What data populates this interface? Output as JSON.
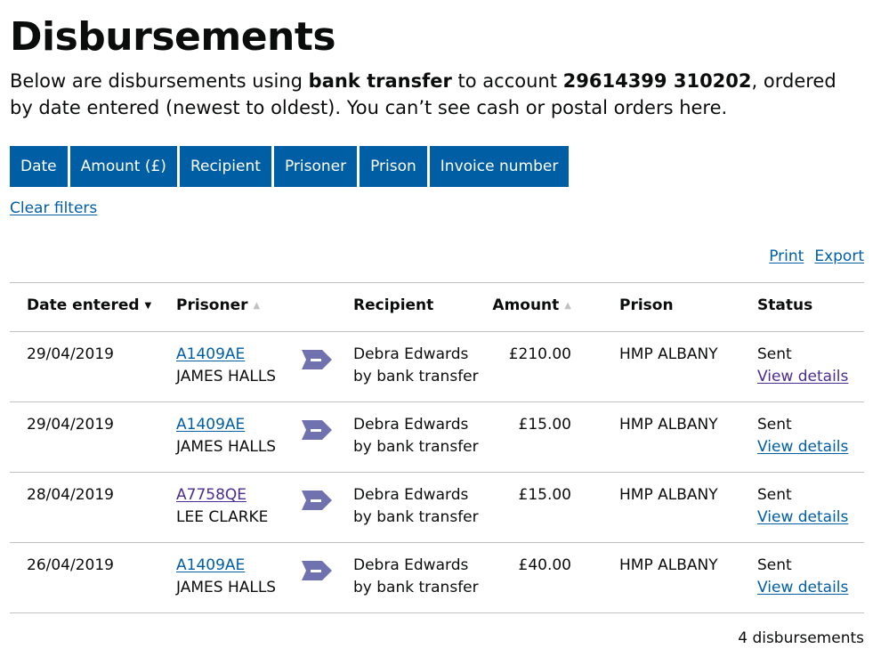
{
  "page": {
    "title": "Disbursements",
    "lede": {
      "part1": "Below are disbursements using ",
      "bold1": "bank transfer",
      "part2": " to account ",
      "bold2": "29614399 310202",
      "part3": ", ordered by date entered (newest to oldest). You can’t see cash or postal orders here."
    }
  },
  "filters": [
    "Date",
    "Amount (£)",
    "Recipient",
    "Prisoner",
    "Prison",
    "Invoice number"
  ],
  "clear_filters": "Clear filters",
  "actions": {
    "print": "Print",
    "export": "Export"
  },
  "table": {
    "headers": {
      "date": "Date entered",
      "prisoner": "Prisoner",
      "recipient": "Recipient",
      "amount": "Amount",
      "prison": "Prison",
      "status": "Status"
    },
    "rows": [
      {
        "date": "29/04/2019",
        "prisoner_number": "A1409AE",
        "prisoner_name": "JAMES HALLS",
        "recipient": "Debra Edwards",
        "method": "by bank transfer",
        "amount": "£210.00",
        "prison": "HMP ALBANY",
        "status": "Sent",
        "link": "View details"
      },
      {
        "date": "29/04/2019",
        "prisoner_number": "A1409AE",
        "prisoner_name": "JAMES HALLS",
        "recipient": "Debra Edwards",
        "method": "by bank transfer",
        "amount": "£15.00",
        "prison": "HMP ALBANY",
        "status": "Sent",
        "link": "View details"
      },
      {
        "date": "28/04/2019",
        "prisoner_number": "A7758QE",
        "prisoner_name": "LEE CLARKE",
        "recipient": "Debra Edwards",
        "method": "by bank transfer",
        "amount": "£15.00",
        "prison": "HMP ALBANY",
        "status": "Sent",
        "link": "View details"
      },
      {
        "date": "26/04/2019",
        "prisoner_number": "A1409AE",
        "prisoner_name": "JAMES HALLS",
        "recipient": "Debra Edwards",
        "method": "by bank transfer",
        "amount": "£40.00",
        "prison": "HMP ALBANY",
        "status": "Sent",
        "link": "View details"
      }
    ]
  },
  "footer": {
    "count": "4 disbursements"
  },
  "icons": {
    "sort_active": "chevron-down-icon",
    "sort_inactive": "chevron-up-icon",
    "transfer": "arrow-right-icon"
  },
  "colors": {
    "button": "#005ea5",
    "link": "#005ea5",
    "visited_link": "#4c2c92",
    "arrow": "#6f72af",
    "border": "#bfc1c3"
  }
}
